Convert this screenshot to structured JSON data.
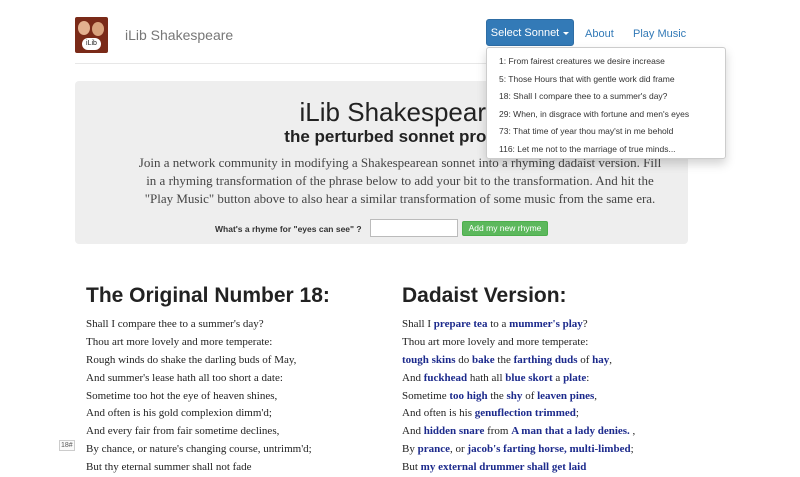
{
  "navbar": {
    "logo_badge": "iLib",
    "brand": "iLib Shakespeare",
    "select_button_label": "Select Sonnet",
    "links": [
      "About",
      "Play Music"
    ]
  },
  "dropdown": {
    "items": [
      "1: From fairest creatures we desire increase",
      "5: Those Hours that with gentle work did frame",
      "18: Shall I compare thee to a summer's day?",
      "29: When, in disgrace with fortune and men's eyes",
      "73: That time of year thou may'st in me behold",
      "116: Let me not to the marriage of true minds..."
    ]
  },
  "jumbotron": {
    "title": "iLib Shakespeare",
    "subtitle": "the perturbed sonnet project",
    "description": "Join a network community in modifying a Shakespearean sonnet into a rhyming dadaist version. Fill in a rhyming transformation of the phrase below to add your bit to the transformation. And hit the \"Play Music\" button above to also hear a similar transformation of some music from the same era.",
    "rhyme_label": "What's a rhyme for \"eyes can see\" ?",
    "rhyme_input_value": "",
    "add_button_label": "Add my new rhyme"
  },
  "original": {
    "title": "The Original Number 18:",
    "lines": [
      "Shall I compare thee to a summer's day?",
      "Thou art more lovely and more temperate:",
      "Rough winds do shake the darling buds of May,",
      "And summer's lease hath all too short a date:",
      "Sometime too hot the eye of heaven shines,",
      "And often is his gold complexion dimm'd;",
      "And every fair from fair sometime declines,",
      "By chance, or nature's changing course, untrimm'd;",
      "But thy eternal summer shall not fade"
    ]
  },
  "dadaist": {
    "title": "Dadaist Version:",
    "lines": [
      [
        {
          "t": "Shall I "
        },
        {
          "t": "prepare tea",
          "b": true
        },
        {
          "t": " to a "
        },
        {
          "t": "mummer's play",
          "b": true
        },
        {
          "t": "?"
        }
      ],
      [
        {
          "t": "Thou art more lovely and more temperate:"
        }
      ],
      [
        {
          "t": "tough skins",
          "b": true
        },
        {
          "t": " do "
        },
        {
          "t": "bake",
          "b": true
        },
        {
          "t": " the "
        },
        {
          "t": "farthing duds",
          "b": true
        },
        {
          "t": " of "
        },
        {
          "t": "hay",
          "b": true
        },
        {
          "t": ","
        }
      ],
      [
        {
          "t": "And "
        },
        {
          "t": "fuckhead",
          "b": true
        },
        {
          "t": " hath all "
        },
        {
          "t": "blue skort",
          "b": true
        },
        {
          "t": " a "
        },
        {
          "t": "plate",
          "b": true
        },
        {
          "t": ":"
        }
      ],
      [
        {
          "t": "Sometime "
        },
        {
          "t": "too high",
          "b": true
        },
        {
          "t": " the "
        },
        {
          "t": "shy",
          "b": true
        },
        {
          "t": " of "
        },
        {
          "t": "leaven pines",
          "b": true
        },
        {
          "t": ","
        }
      ],
      [
        {
          "t": "And often is his "
        },
        {
          "t": "genuflection trimmed",
          "b": true
        },
        {
          "t": ";"
        }
      ],
      [
        {
          "t": "And "
        },
        {
          "t": "hidden snare",
          "b": true
        },
        {
          "t": " from "
        },
        {
          "t": "A man that a lady denies.",
          "b": true
        },
        {
          "t": " ,"
        }
      ],
      [
        {
          "t": "By "
        },
        {
          "t": "prance",
          "b": true
        },
        {
          "t": ", or "
        },
        {
          "t": "jacob's farting horse, multi-limbed",
          "b": true
        },
        {
          "t": ";"
        }
      ],
      [
        {
          "t": "But "
        },
        {
          "t": "my external drummer shall get laid",
          "b": true
        }
      ]
    ]
  },
  "stray_fragment": "18#"
}
